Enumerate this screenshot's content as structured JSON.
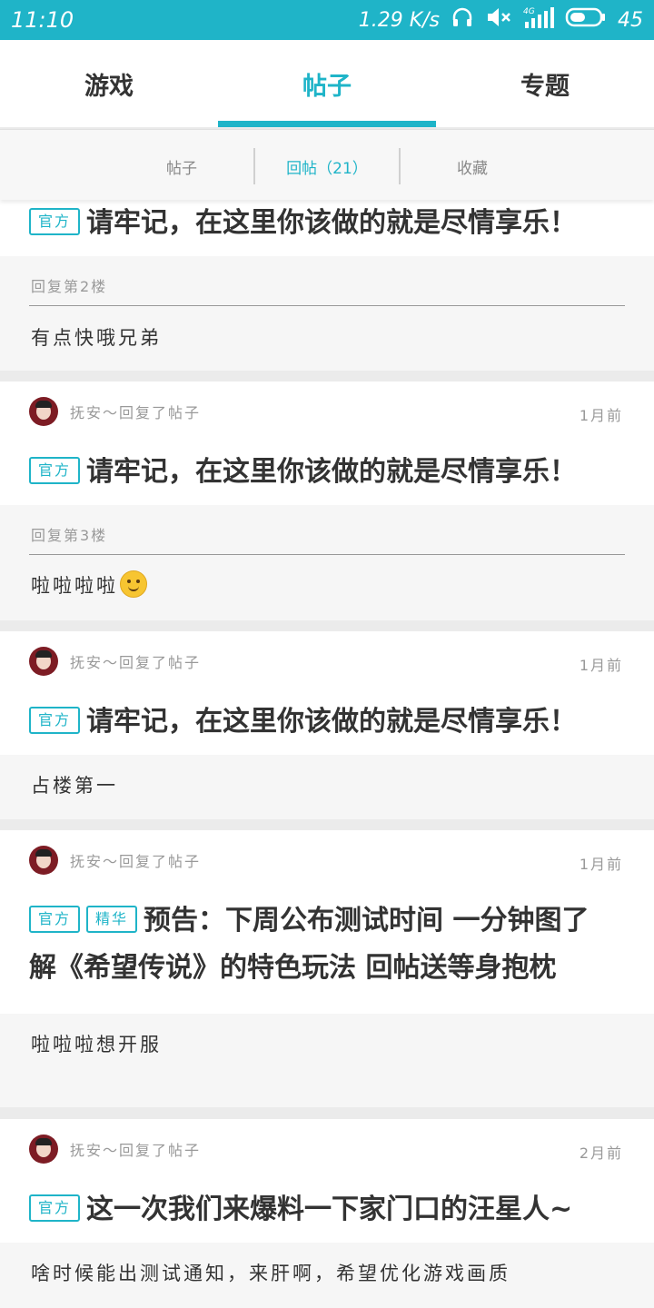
{
  "status_bar": {
    "time": "11:10",
    "net_speed": "1.29 K/s",
    "network": "4G",
    "battery": "45",
    "icons": [
      "headphones-icon",
      "mute-icon",
      "signal-icon",
      "battery-icon"
    ]
  },
  "main_tabs": [
    {
      "label": "游戏",
      "active": false
    },
    {
      "label": "帖子",
      "active": true
    },
    {
      "label": "专题",
      "active": false
    }
  ],
  "sub_tabs": [
    {
      "label": "帖子",
      "active": false
    },
    {
      "label": "回帖（21）",
      "active": true
    },
    {
      "label": "收藏",
      "active": false
    }
  ],
  "accent_color": "#1fb4c8",
  "posts": [
    {
      "tags": [
        "官方"
      ],
      "title": "请牢记，在这里你该做的就是尽情享乐！",
      "quote": "回复第2楼",
      "reply": "有点快哦兄弟"
    },
    {
      "user": "抚安～回复了帖子",
      "time": "1月前",
      "tags": [
        "官方"
      ],
      "title": "请牢记，在这里你该做的就是尽情享乐！",
      "quote": "回复第3楼",
      "reply": "啦啦啦啦",
      "reply_emoji": "smile-emoji-icon"
    },
    {
      "user": "抚安～回复了帖子",
      "time": "1月前",
      "tags": [
        "官方"
      ],
      "title": "请牢记，在这里你该做的就是尽情享乐！",
      "reply": "占楼第一"
    },
    {
      "user": "抚安～回复了帖子",
      "time": "1月前",
      "tags": [
        "官方",
        "精华"
      ],
      "title_line1": "预告：下周公布测试时间 一分钟图了",
      "title_line2": "解《希望传说》的特色玩法  回帖送等身抱枕",
      "reply": "啦啦啦想开服"
    },
    {
      "user": "抚安～回复了帖子",
      "time": "2月前",
      "tags": [
        "官方"
      ],
      "title": "这一次我们来爆料一下家门口的汪星人~",
      "reply": "啥时候能出测试通知，来肝啊，希望优化游戏画质"
    }
  ]
}
